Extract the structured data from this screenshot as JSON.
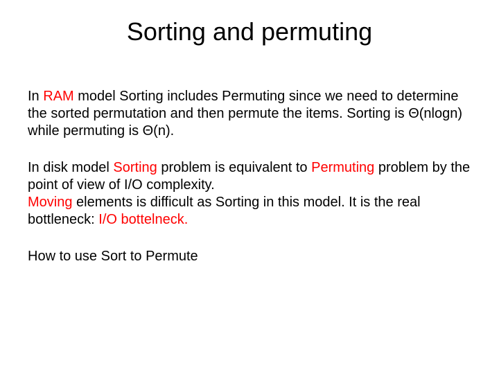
{
  "title": "Sorting and permuting",
  "p1a": "In ",
  "p1b": "RAM",
  "p1c": " model Sorting includes Permuting since we need to determine the sorted permutation and then permute the items. Sorting is ",
  "p1d": "Θ(nlogn)",
  "p1e": " while permuting is ",
  "p1f": "Θ(n).",
  "p2a": "In disk model ",
  "p2b": "Sorting",
  "p2c": " problem is equivalent to ",
  "p2d": "Permuting",
  "p2e": " problem by the point of view of I/O complexity.",
  "p2f": "Moving",
  "p2g": " elements is difficult as Sorting in this model. It is the real bottleneck: ",
  "p2h": "I/O bottelneck.",
  "p3": "How to use Sort to Permute"
}
